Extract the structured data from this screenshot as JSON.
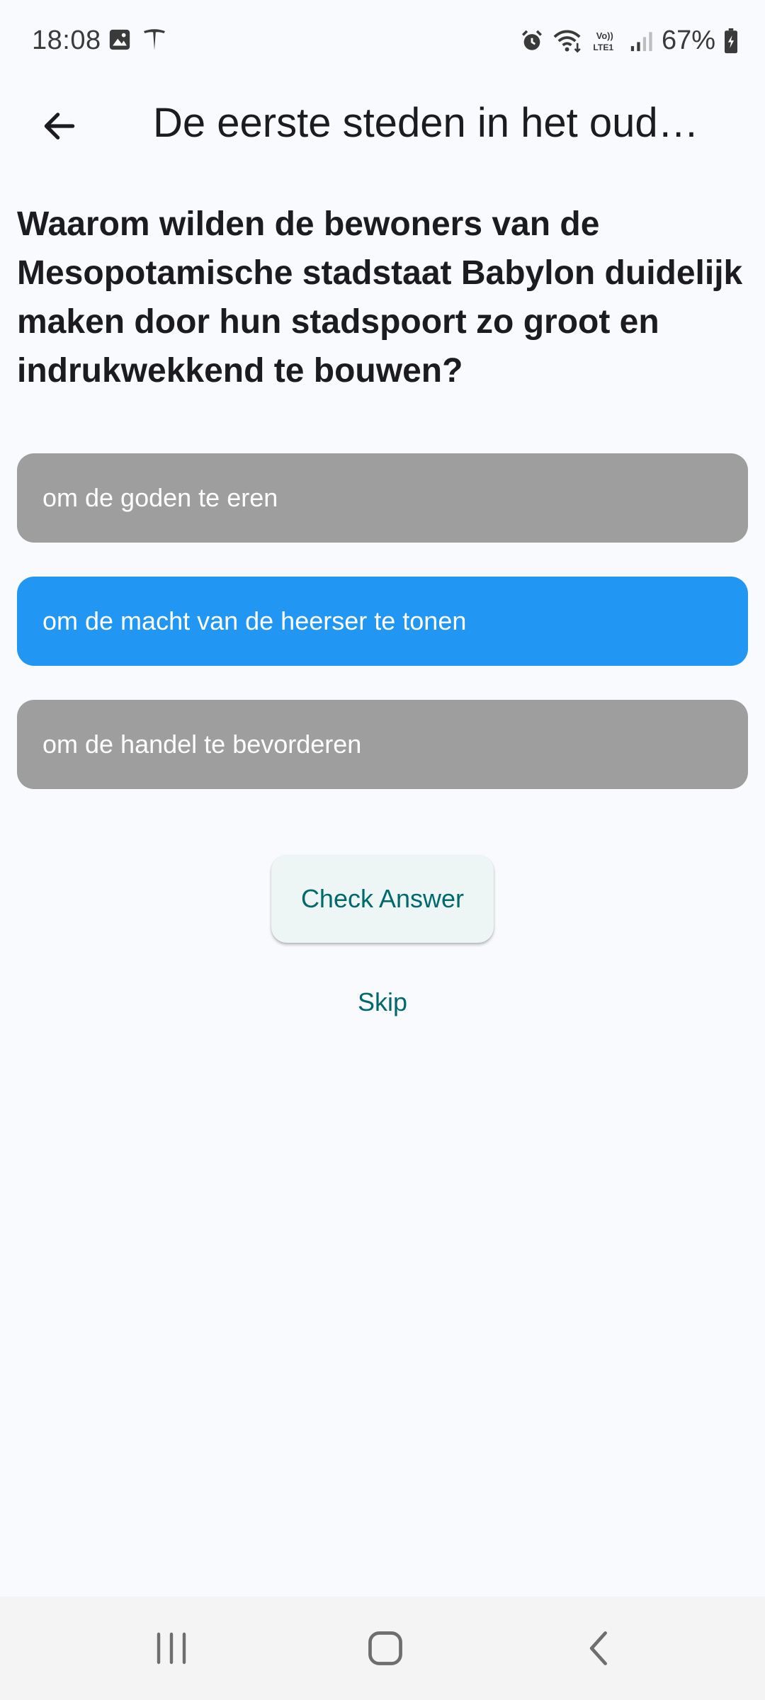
{
  "status_bar": {
    "time": "18:08",
    "battery": "67%",
    "icons": [
      "gallery-icon",
      "tesla-icon",
      "alarm-icon",
      "wifi-icon",
      "volte-icon",
      "signal-icon",
      "battery-icon"
    ]
  },
  "app_bar": {
    "title": "De eerste steden in het oude Mesopotamië",
    "back_icon": "arrow-left-icon"
  },
  "quiz": {
    "question": "Waarom wilden de bewoners van de Mesopotamische stadstaat Babylon duidelijk maken door hun stadspoort zo groot en indrukwekkend te bouwen?",
    "options": [
      {
        "label": "om de goden te eren",
        "selected": false
      },
      {
        "label": "om de macht van de heerser te tonen",
        "selected": true
      },
      {
        "label": "om de handel te bevorderen",
        "selected": false
      }
    ],
    "check_label": "Check Answer",
    "skip_label": "Skip"
  },
  "colors": {
    "background": "#F8FAFD",
    "option_default": "#9E9E9E",
    "option_selected": "#2196F3",
    "accent": "#00696B"
  },
  "nav_bar": {
    "icons": [
      "recent-apps-icon",
      "home-icon",
      "back-icon"
    ]
  }
}
